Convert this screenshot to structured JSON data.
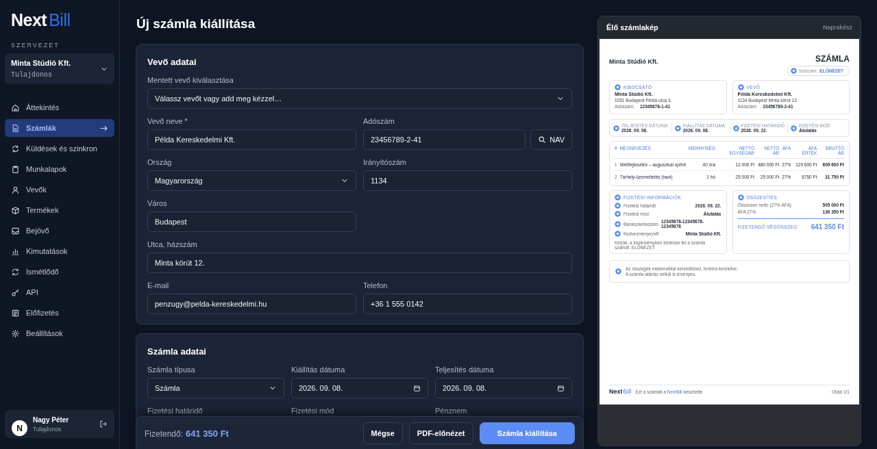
{
  "brand": {
    "part_a": "Next",
    "part_b": "Bill"
  },
  "sidebar": {
    "section_label": "SZERVEZET",
    "org": {
      "name": "Minta Stúdió Kft.",
      "role": "Tulajdonos"
    },
    "items": [
      {
        "label": "Áttekintés",
        "selected": false
      },
      {
        "label": "Számlák",
        "selected": true
      },
      {
        "label": "Küldések és szinkron",
        "selected": false
      },
      {
        "label": "Munkalapok",
        "selected": false
      },
      {
        "label": "Vevők",
        "selected": false
      },
      {
        "label": "Termékek",
        "selected": false
      },
      {
        "label": "Bejövő",
        "selected": false
      },
      {
        "label": "Kimutatások",
        "selected": false
      },
      {
        "label": "Ismétlődő",
        "selected": false
      },
      {
        "label": "API",
        "selected": false
      },
      {
        "label": "Előfizetés",
        "selected": false
      },
      {
        "label": "Beállítások",
        "selected": false
      }
    ],
    "user": {
      "initial": "N",
      "name": "Nagy Péter",
      "role": "Tulajdonos"
    }
  },
  "page_title": "Új számla kiállítása",
  "cards": [
    {
      "title": "Vevő adatai",
      "fields": [
        {
          "label": "Mentett vevő kiválasztása",
          "value": "Válassz vevőt vagy add meg kézzel…",
          "kind": "select",
          "wide": true
        },
        {
          "label": "Vevő neve *",
          "value": "Példa Kereskedelmi Kft.",
          "kind": "text"
        },
        {
          "label": "Adószám",
          "value": "23456789-2-41",
          "kind": "text",
          "action": "NAV"
        },
        {
          "label": "Ország",
          "value": "Magyarország",
          "kind": "select"
        },
        {
          "label": "Irányítószám",
          "value": "1134",
          "kind": "text"
        },
        {
          "label": "Város",
          "value": "Budapest",
          "kind": "text"
        },
        {
          "label": "Utca, házszám",
          "value": "Minta körút 12.",
          "kind": "text",
          "wide": true
        },
        {
          "label": "E-mail",
          "value": "penzugy@pelda-kereskedelmi.hu",
          "kind": "text"
        },
        {
          "label": "Telefon",
          "value": "+36 1 555 0142",
          "kind": "text"
        }
      ]
    },
    {
      "title": "Számla adatai",
      "fields": [
        {
          "label": "Számla típusa",
          "value": "Számla",
          "kind": "select"
        },
        {
          "label": "Kiállítás dátuma",
          "value": "2026. 09. 08.",
          "kind": "date"
        },
        {
          "label": "Teljesítés dátuma",
          "value": "2026. 09. 08.",
          "kind": "date"
        },
        {
          "label": "Fizetési határidő"
        },
        {
          "label": "Fizetési mód"
        },
        {
          "label": "Pénznem"
        }
      ]
    }
  ],
  "action_bar": {
    "total_label": "Fizetendő:",
    "total": "641 350 Ft",
    "buttons": [
      {
        "label": "Mégse",
        "kind": "secondary"
      },
      {
        "label": "PDF-előnézet",
        "kind": "secondary"
      },
      {
        "label": "Számla kiállítása",
        "kind": "primary"
      }
    ]
  },
  "preview": {
    "title": "Élő számlakép",
    "status": "Naprakész",
    "invoice": {
      "seller": "Minta Stúdió Kft.",
      "doc_title": "SZÁMLA",
      "number_label": "Sorszám:",
      "number": "ELŐNÉZET",
      "parties": [
        {
          "heading": "KIBOCSÁTÓ",
          "name": "Minta Stúdió Kft.",
          "address": "1051 Budapest Példa utca 3.",
          "tax_label": "Adószám:",
          "tax": "12345678-1-41"
        },
        {
          "heading": "VEVŐ",
          "name": "Példa Kereskedelmi Kft.",
          "address": "1134 Budapest Minta körút 12.",
          "tax_label": "Adószám:",
          "tax": "23456789-2-41"
        }
      ],
      "dates": [
        {
          "label": "TELJESÍTÉS DÁTUMA",
          "value": "2026. 09. 08."
        },
        {
          "label": "KIÁLLÍTÁS DÁTUMA",
          "value": "2026. 09. 08."
        },
        {
          "label": "FIZETÉSI HATÁRIDŐ",
          "value": "2026. 09. 22."
        },
        {
          "label": "FIZETÉSI MÓD",
          "value": "Átutalás"
        }
      ],
      "columns": [
        "#",
        "MEGNEVEZÉS",
        "MENNYISÉG",
        "NETTÓ EGYSÉGÁR",
        "NETTÓ ÁR",
        "ÁFA",
        "ÁFA ÉRTÉK",
        "BRUTTÓ ÁR"
      ],
      "rows": [
        [
          "1",
          "Webfejlesztés – augusztusi sprint",
          "40 óra",
          "12 000 Ft",
          "480 000 Ft",
          "27%",
          "129 600 Ft",
          "609 600 Ft"
        ],
        [
          "2",
          "Tárhely-üzemeltetés (havi)",
          "1 hó",
          "25 000 Ft",
          "25 000 Ft",
          "27%",
          "6750 Ft",
          "31 750 Ft"
        ]
      ],
      "payment": {
        "heading": "FIZETÉSI INFORMÁCIÓK",
        "rows": [
          {
            "label": "Fizetési határidő",
            "value": "2026. 09. 22."
          },
          {
            "label": "Fizetési mód",
            "value": "Átutalás"
          },
          {
            "label": "Bankszámlaszám",
            "value": "12345678-12345678-12345678"
          },
          {
            "label": "Kedvezményezett",
            "value": "Minta Stúdió Kft."
          }
        ],
        "note": "Kérjük, a közleményben tüntesse fel a számla számát: ELŐNÉZET"
      },
      "summary": {
        "heading": "ÖSSZESÍTÉS",
        "rows": [
          {
            "label": "Összesen nettó (27% ÁFA)",
            "value": "505 000 Ft"
          },
          {
            "label": "ÁFA 27%",
            "value": "136 350 Ft"
          }
        ],
        "total_label": "FIZETENDŐ VÉGÖSSZEG",
        "total": "641 350 Ft"
      },
      "notes": [
        "Az összegek matematikai kerekítéssel, forintra kerekítve.",
        "A számla aláírás nélkül is érvényes."
      ],
      "footer": {
        "logo_a": "Next",
        "logo_b": "Bill",
        "credit_prefix": "Ezt a számlát a",
        "credit_brand": "NextBill",
        "credit_suffix": "készítette",
        "page": "Oldal 1/1"
      }
    }
  }
}
